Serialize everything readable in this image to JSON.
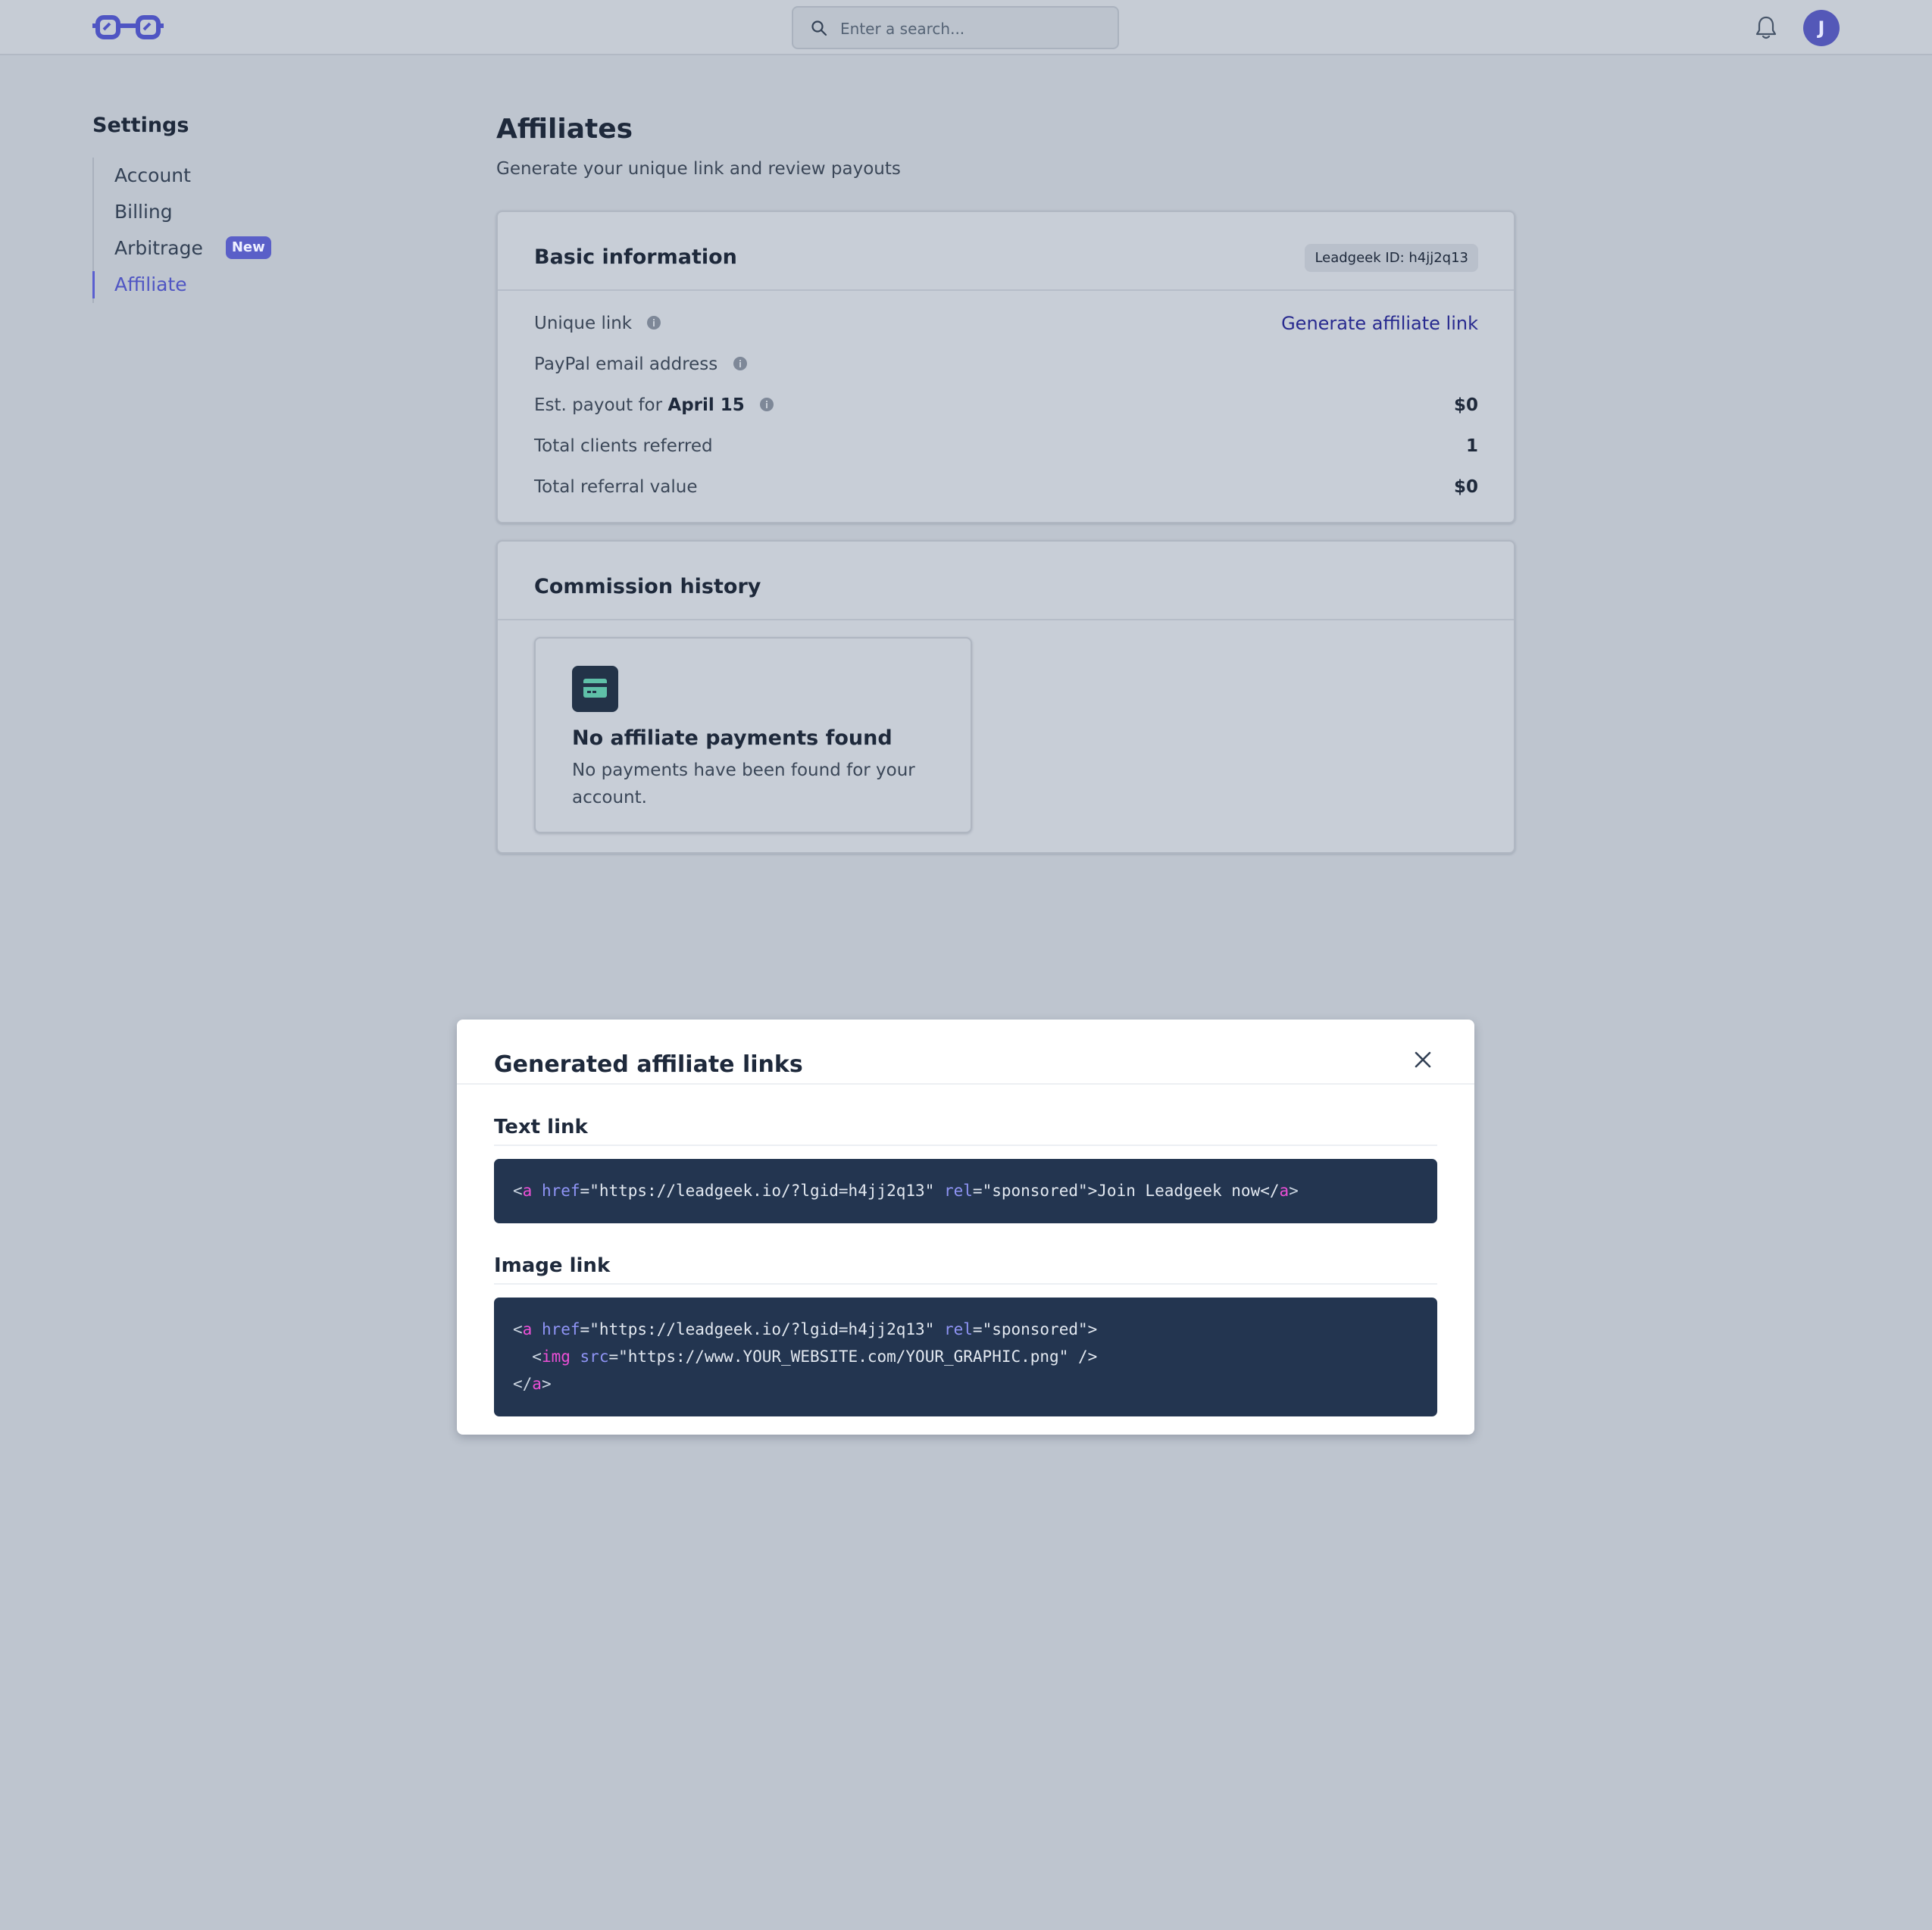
{
  "header": {
    "search_placeholder": "Enter a search...",
    "avatar_initial": "J"
  },
  "sidebar": {
    "title": "Settings",
    "items": [
      {
        "label": "Account"
      },
      {
        "label": "Billing"
      },
      {
        "label": "Arbitrage",
        "badge": "New"
      },
      {
        "label": "Affiliate",
        "active": true
      }
    ]
  },
  "main": {
    "title": "Affiliates",
    "subtitle": "Generate your unique link and review payouts"
  },
  "basic_info": {
    "title": "Basic information",
    "id_chip": "Leadgeek ID: h4jj2q13",
    "rows": {
      "unique_link": {
        "label": "Unique link",
        "action": "Generate affiliate link"
      },
      "paypal": {
        "label": "PayPal email address"
      },
      "payout": {
        "label_prefix": "Est. payout for",
        "label_date": "April 15",
        "value": "$0"
      },
      "clients": {
        "label": "Total clients referred",
        "value": "1"
      },
      "referral_value": {
        "label": "Total referral value",
        "value": "$0"
      }
    }
  },
  "commission_history": {
    "title": "Commission history",
    "empty_title": "No affiliate payments found",
    "empty_desc": "No payments have been found for your account."
  },
  "modal": {
    "title": "Generated affiliate links",
    "text_link_label": "Text link",
    "image_link_label": "Image link",
    "text_code": {
      "lt": "<",
      "tag_a": "a",
      "attr_href": "href",
      "href_val": "=\"https://leadgeek.io/?lgid=h4jj2q13\" ",
      "attr_rel": "rel",
      "rel_val": "=\"sponsored\">Join Leadgeek now</",
      "tag_a_close": "a",
      "gt": ">"
    },
    "image_code": {
      "l1_lt": "<",
      "l1_tag": "a",
      "l1_href": "href",
      "l1_href_val": "=\"https://leadgeek.io/?lgid=h4jj2q13\" ",
      "l1_rel": "rel",
      "l1_rel_val": "=\"sponsored\">",
      "l2_lt": "  <",
      "l2_tag": "img",
      "l2_src": "src",
      "l2_src_val": "=\"https://www.YOUR_WEBSITE.com/YOUR_GRAPHIC.png\" />",
      "l3_lt": "</",
      "l3_tag": "a",
      "l3_gt": ">"
    }
  },
  "colors": {
    "accent": "#5a5fd0",
    "code_bg": "#233550",
    "code_tag": "#ec4fd6",
    "code_attr": "#8f94f5"
  }
}
